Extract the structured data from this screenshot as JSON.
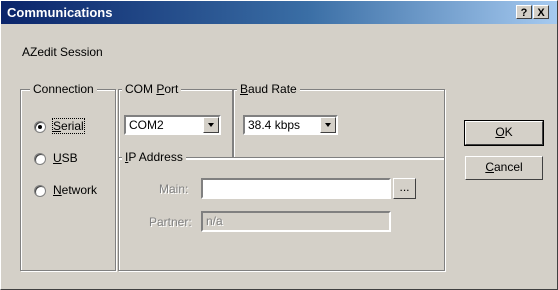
{
  "window": {
    "title": "Communications",
    "help_glyph": "?",
    "close_glyph": "X"
  },
  "session_label": "AZedit Session",
  "connection": {
    "group_label": "Connection",
    "options": [
      {
        "label": "Serial",
        "accel": "S",
        "rest": "erial",
        "selected": true
      },
      {
        "label": "USB",
        "accel": "U",
        "rest": "SB",
        "selected": false
      },
      {
        "label": "Network",
        "accel": "N",
        "rest": "etwork",
        "selected": false
      }
    ]
  },
  "com_port": {
    "label_pre": "COM ",
    "label_accel": "P",
    "label_post": "ort",
    "value": "COM2"
  },
  "baud_rate": {
    "label_accel": "B",
    "label_post": "aud Rate",
    "value": "38.4 kbps"
  },
  "ip_address": {
    "label_accel": "I",
    "label_post": "P Address",
    "main_label": "Main:",
    "main_value": "",
    "browse_label": "...",
    "partner_label": "Partner:",
    "partner_value": "n/a"
  },
  "buttons": {
    "ok_accel": "O",
    "ok_post": "K",
    "cancel_accel": "C",
    "cancel_post": "ancel"
  },
  "colors": {
    "face": "#d4d0c8",
    "title_start": "#0a246a",
    "title_end": "#a6caf0"
  }
}
